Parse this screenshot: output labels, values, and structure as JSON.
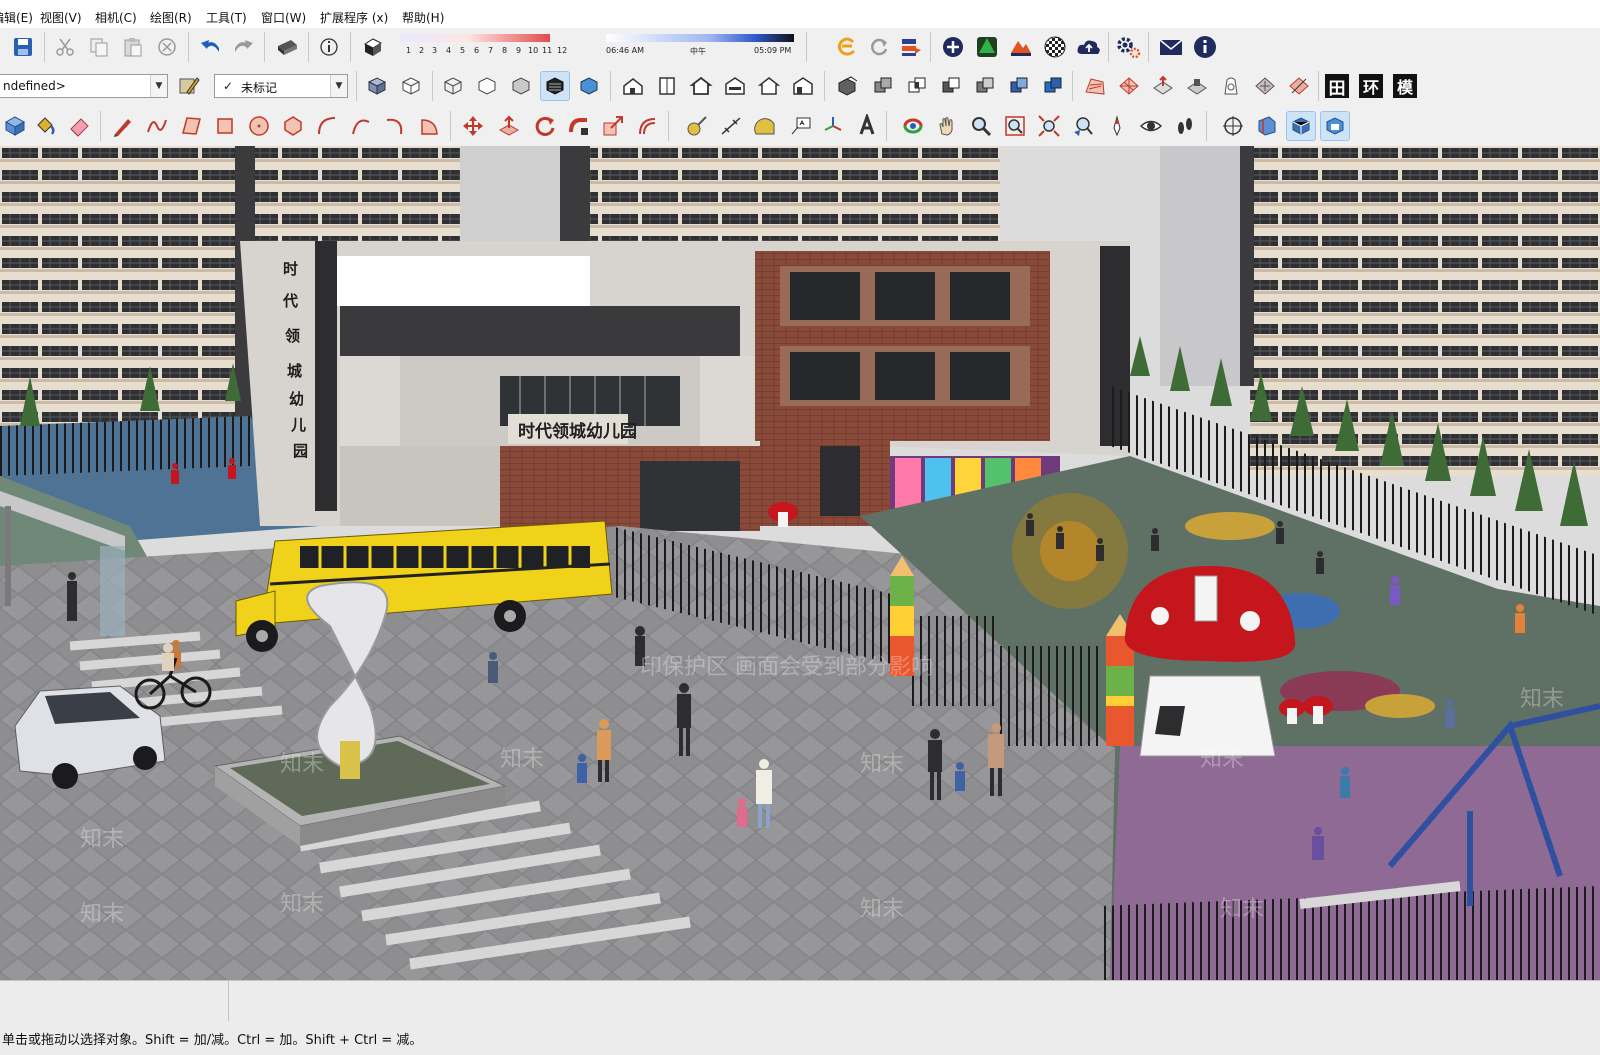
{
  "menu": {
    "items": [
      {
        "label": "编辑(E)"
      },
      {
        "label": "视图(V)"
      },
      {
        "label": "相机(C)"
      },
      {
        "label": "绘图(R)"
      },
      {
        "label": "工具(T)"
      },
      {
        "label": "窗口(W)"
      },
      {
        "label": "扩展程序 (x)"
      },
      {
        "label": "帮助(H)"
      }
    ]
  },
  "shadow": {
    "months": [
      "1",
      "2",
      "3",
      "4",
      "5",
      "6",
      "7",
      "8",
      "9",
      "10",
      "11",
      "12"
    ],
    "time_start": "06:46 AM",
    "time_mid": "中午",
    "time_end": "05:09 PM"
  },
  "style_select": {
    "value": "ndefined>"
  },
  "tag_select": {
    "check": "✓",
    "value": "未标记"
  },
  "toolbar_text": {
    "views_label": "田",
    "env_label": "环",
    "model_label": "模"
  },
  "model": {
    "sign_horizontal": "时代领城幼儿园",
    "sign_vertical": [
      "时",
      "代",
      "领",
      "城",
      "幼",
      "儿",
      "园"
    ]
  },
  "watermark": {
    "brand": "知末",
    "notice": "印保护区 画面会受到部分影响"
  },
  "status": {
    "message": "单击或拖动以选择对象。Shift = 加/减。Ctrl = 加。Shift + Ctrl = 减。"
  },
  "colors": {
    "ground": "#8d8d8f",
    "playground": "#5f7064",
    "purple_court": "#8e6a95",
    "brick": "#8a4a3a",
    "bus": "#f0d21a",
    "mushroom_red": "#c4161c",
    "shadow_gradient": [
      "#2d57c9",
      "#ffffff",
      "#e34b4b"
    ]
  }
}
